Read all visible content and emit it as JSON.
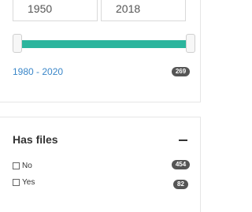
{
  "date_range": {
    "from_year": "1950",
    "to_year": "2018",
    "selected_range": "1980 - 2020",
    "selected_count": "269"
  },
  "has_files": {
    "title": "Has files",
    "options": [
      {
        "label": "No",
        "count": "454"
      },
      {
        "label": "Yes",
        "count": "82"
      }
    ]
  },
  "colors": {
    "slider_fill": "#2bb59d",
    "range_link": "#3a86c8",
    "badge_bg": "#555555"
  },
  "icons": {
    "collapse": "minus-icon"
  }
}
